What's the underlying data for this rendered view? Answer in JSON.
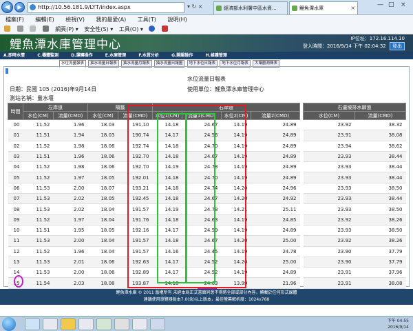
{
  "browser": {
    "address": "http://10.56.181.9/LYT/index.aspx",
    "address_controls": "▾ ↻ ×",
    "tabs": [
      "經濟部水利署中區水資...",
      "鯉魚潭水庫"
    ],
    "window_controls": [
      "—",
      "□",
      "×"
    ],
    "menu": [
      "檔案(F)",
      "編輯(E)",
      "檢視(V)",
      "我的最愛(A)",
      "工具(T)",
      "說明(H)"
    ],
    "command_bar": [
      "網頁(P) ▾",
      "安全性(S) ▾",
      "工具(O) ▾"
    ]
  },
  "site": {
    "title": "鯉魚潭水庫管理中心",
    "ip": "IP位址：172.16.114.10",
    "login": "登入時間：2016/9/14 下午 02:04:32",
    "logout": "登出",
    "nav": [
      "A.即時水情",
      "C.壩體監測",
      "D.運轉操作",
      "E.水庫管理",
      "F.水質分析",
      "G.開關操作",
      "H.維護管理"
    ],
    "sub_tabs": [
      "水位流量報表",
      "抽水流量日報表",
      "抽水流量月報表",
      "抽水流量日報圖",
      "地下水位日報表",
      "地下水位月報表",
      "大壩觀測簡表"
    ]
  },
  "report": {
    "title": "水位流量日報表",
    "date": "日期：民國 105 (2016)年9月14日",
    "unit": "使用單位：鯉魚潭水庫管理中心",
    "station": "測站名稱：量水堰"
  },
  "table": {
    "group_headers": [
      "時間",
      "左岸道",
      "隔牆",
      "右岸道"
    ],
    "sub_headers": [
      "水位(CM)",
      "流量(CMD)",
      "水位(CM)",
      "流量(CMD)",
      "水位1(CM)",
      "流量1(CMD)",
      "水位2(CM)",
      "流量2(CMD)"
    ],
    "side_group_header": "右邊坡排水廊道",
    "side_sub_headers": [
      "水位(CM)",
      "流量(CMD)"
    ],
    "rows": [
      [
        "00",
        "11.52",
        "1.96",
        "18.03",
        "191.10",
        "14.18",
        "24.67",
        "14.19",
        "24.89",
        "23.92",
        "38.32"
      ],
      [
        "01",
        "11.51",
        "1.94",
        "18.03",
        "190.74",
        "14.17",
        "24.56",
        "14.19",
        "24.89",
        "23.91",
        "38.08"
      ],
      [
        "02",
        "11.52",
        "1.98",
        "18.06",
        "192.74",
        "14.18",
        "24.70",
        "14.19",
        "24.89",
        "23.94",
        "38.62"
      ],
      [
        "03",
        "11.51",
        "1.96",
        "18.06",
        "192.70",
        "14.18",
        "24.67",
        "14.19",
        "24.89",
        "23.93",
        "38.44"
      ],
      [
        "04",
        "11.52",
        "1.98",
        "18.06",
        "192.70",
        "14.19",
        "24.78",
        "14.19",
        "24.89",
        "23.93",
        "38.44"
      ],
      [
        "05",
        "11.52",
        "1.97",
        "18.05",
        "192.01",
        "14.18",
        "24.70",
        "14.19",
        "24.89",
        "23.93",
        "38.44"
      ],
      [
        "06",
        "11.53",
        "2.00",
        "18.07",
        "193.21",
        "14.18",
        "24.74",
        "14.20",
        "24.96",
        "23.93",
        "38.50"
      ],
      [
        "07",
        "11.53",
        "2.02",
        "18.05",
        "192.45",
        "14.18",
        "24.67",
        "14.20",
        "24.92",
        "23.93",
        "38.44"
      ],
      [
        "08",
        "11.53",
        "2.02",
        "18.04",
        "191.57",
        "14.19",
        "24.78",
        "14.21",
        "25.11",
        "23.93",
        "38.50"
      ],
      [
        "09",
        "11.52",
        "1.97",
        "18.04",
        "191.76",
        "14.18",
        "24.63",
        "14.19",
        "24.85",
        "23.92",
        "38.26"
      ],
      [
        "10",
        "11.51",
        "1.95",
        "18.05",
        "192.16",
        "14.17",
        "24.59",
        "14.19",
        "24.89",
        "23.93",
        "38.50"
      ],
      [
        "11",
        "11.53",
        "2.00",
        "18.04",
        "191.57",
        "14.18",
        "24.67",
        "14.20",
        "25.00",
        "23.92",
        "38.26"
      ],
      [
        "12",
        "11.52",
        "1.96",
        "18.04",
        "191.57",
        "14.16",
        "24.45",
        "14.19",
        "24.78",
        "23.90",
        "37.79"
      ],
      [
        "13",
        "11.53",
        "2.01",
        "18.06",
        "192.63",
        "14.17",
        "24.52",
        "14.20",
        "25.00",
        "23.90",
        "37.79"
      ],
      [
        "14",
        "11.53",
        "2.00",
        "18.06",
        "192.89",
        "14.17",
        "24.52",
        "14.19",
        "24.89",
        "23.91",
        "37.96"
      ],
      [
        "15",
        "11.54",
        "2.03",
        "18.08",
        "193.87",
        "14.18",
        "24.63",
        "13.99",
        "21.96",
        "23.91",
        "38.08"
      ]
    ]
  },
  "footer": {
    "line1": "鯉魚潭水庫 © 2011 版權所有 未經本局正式書面同意不得將全部或部分內容，轉載於任何形式媒體",
    "line2": "建議使用瀏覽器版本7.0(含)以上版本，最佳螢幕解析度：1024x768"
  },
  "taskbar": {
    "time": "下午 04:55",
    "date": "2016/9/14"
  },
  "colors": {
    "highlight_red": "#e21c24",
    "highlight_green": "#2dc33a",
    "highlight_purple": "#c81cc8",
    "header_bg": "#5a5a5a",
    "nav_bg": "#1c3f66"
  }
}
